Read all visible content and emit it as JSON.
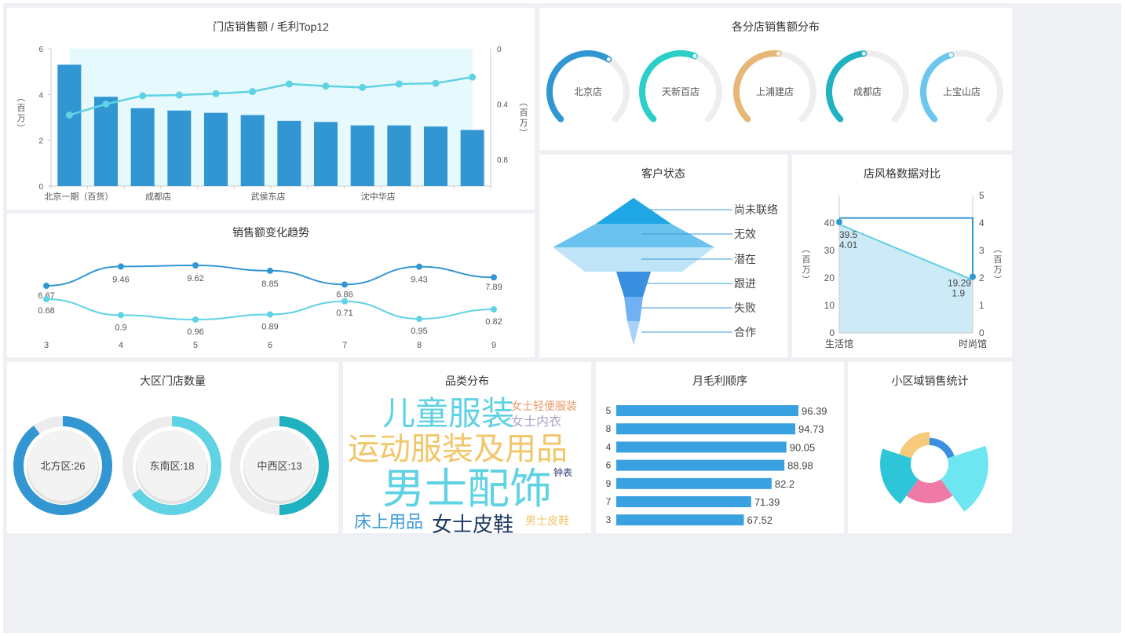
{
  "colors": {
    "blue": "#3296d3",
    "cyan": "#5fd2e3",
    "teal": "#20b2c0",
    "light": "#e6f9fc",
    "orange": "#e8b676",
    "sky": "#6cc7ee"
  },
  "chart_data": [
    {
      "id": "top12",
      "type": "bar",
      "title": "门店销售额 / 毛利Top12",
      "categories": [
        "北京一期（百货）",
        "",
        "成都店",
        "",
        "",
        "武侯东店",
        "",
        "",
        "沈中华店",
        "",
        "",
        ""
      ],
      "x_tick_labels": [
        "北京一期（百货）",
        "成都店",
        "武侯东店",
        "沈中华店"
      ],
      "series": [
        {
          "type": "bar",
          "values": [
            5.3,
            3.9,
            3.4,
            3.3,
            3.2,
            3.1,
            2.85,
            2.8,
            2.65,
            2.65,
            2.6,
            2.45
          ]
        },
        {
          "type": "line",
          "axis": "right",
          "values": [
            0.48,
            0.4,
            0.34,
            0.335,
            0.325,
            0.31,
            0.255,
            0.27,
            0.28,
            0.255,
            0.25,
            0.205
          ]
        }
      ],
      "ylabel": "（百万）",
      "ylabel_right": "（百万）",
      "ylim": [
        0,
        6
      ],
      "y_ticks": [
        "0",
        "2",
        "4",
        "6"
      ],
      "ylim_right": [
        0,
        1
      ],
      "y_ticks_right": [
        "0",
        "0.4",
        "0.8"
      ],
      "right_axis_inverted": true
    },
    {
      "id": "trend",
      "type": "line",
      "title": "销售额变化趋势",
      "x": [
        "3",
        "4",
        "5",
        "6",
        "7",
        "8",
        "9"
      ],
      "series": [
        {
          "values": [
            6.67,
            9.46,
            9.62,
            8.85,
            6.86,
            9.43,
            7.89
          ],
          "labels": [
            "6.67",
            "9.46",
            "9.62",
            "8.85",
            "6.86",
            "9.43",
            "7.89"
          ]
        },
        {
          "values": [
            0.68,
            0.9,
            0.96,
            0.89,
            0.71,
            0.95,
            0.82
          ],
          "labels": [
            "0.68",
            "0.9",
            "0.96",
            "0.89",
            "0.71",
            "0.95",
            "0.82"
          ]
        }
      ]
    },
    {
      "id": "branch_gauges",
      "type": "pie",
      "title": "各分店销售额分布",
      "categories": [
        "北京店",
        "天新百店",
        "上浦建店",
        "成都店",
        "上宝山店"
      ],
      "values": [
        0.62,
        0.58,
        0.52,
        0.48,
        0.44
      ]
    },
    {
      "id": "funnel",
      "type": "funnel",
      "title": "客户状态",
      "categories": [
        "尚未联络",
        "无效",
        "潜在",
        "跟进",
        "失败",
        "合作"
      ]
    },
    {
      "id": "style_compare",
      "type": "line",
      "title": "店风格数据对比",
      "categories": [
        "生活馆",
        "时尚馆"
      ],
      "series": [
        {
          "axis": "left",
          "values": [
            39.5,
            19.29
          ],
          "labels": [
            "39.5",
            "19.29"
          ]
        },
        {
          "axis": "right",
          "values": [
            4.01,
            1.9
          ],
          "labels": [
            "4.01",
            "1.9"
          ]
        }
      ],
      "ylabel": "（百万）",
      "ylabel_right": "（百万）",
      "ylim": [
        0,
        50
      ],
      "y_ticks": [
        "0",
        "10",
        "20",
        "30",
        "40"
      ],
      "ylim_right": [
        0,
        5
      ],
      "y_ticks_right": [
        "0",
        "1",
        "2",
        "3",
        "4",
        "5"
      ]
    },
    {
      "id": "region_stores",
      "type": "pie",
      "title": "大区门店数量",
      "categories": [
        "北方区:26",
        "东南区:18",
        "中西区:13"
      ],
      "values": [
        26,
        18,
        13
      ],
      "fraction_of_ring": [
        0.9,
        0.65,
        0.5
      ]
    },
    {
      "id": "wordcloud",
      "type": "wordcloud",
      "title": "品类分布",
      "words": [
        "儿童服装",
        "女士轻便服装",
        "女士内衣",
        "运动服装及用品",
        "钟表",
        "男士配饰",
        "床上用品",
        "女士皮鞋",
        "男士皮鞋"
      ]
    },
    {
      "id": "monthly_margin",
      "type": "bar",
      "title": "月毛利顺序",
      "categories": [
        "5",
        "8",
        "4",
        "6",
        "9",
        "7",
        "3"
      ],
      "values": [
        96.39,
        94.73,
        90.05,
        88.98,
        82.2,
        71.39,
        67.52
      ],
      "labels": [
        "96.39",
        "94.73",
        "90.05",
        "88.98",
        "82.2",
        "71.39",
        "67.52"
      ],
      "orientation": "horizontal"
    },
    {
      "id": "small_region",
      "type": "pie",
      "title": "小区域销售统计",
      "values": [
        10,
        55,
        28,
        42,
        18
      ]
    }
  ]
}
